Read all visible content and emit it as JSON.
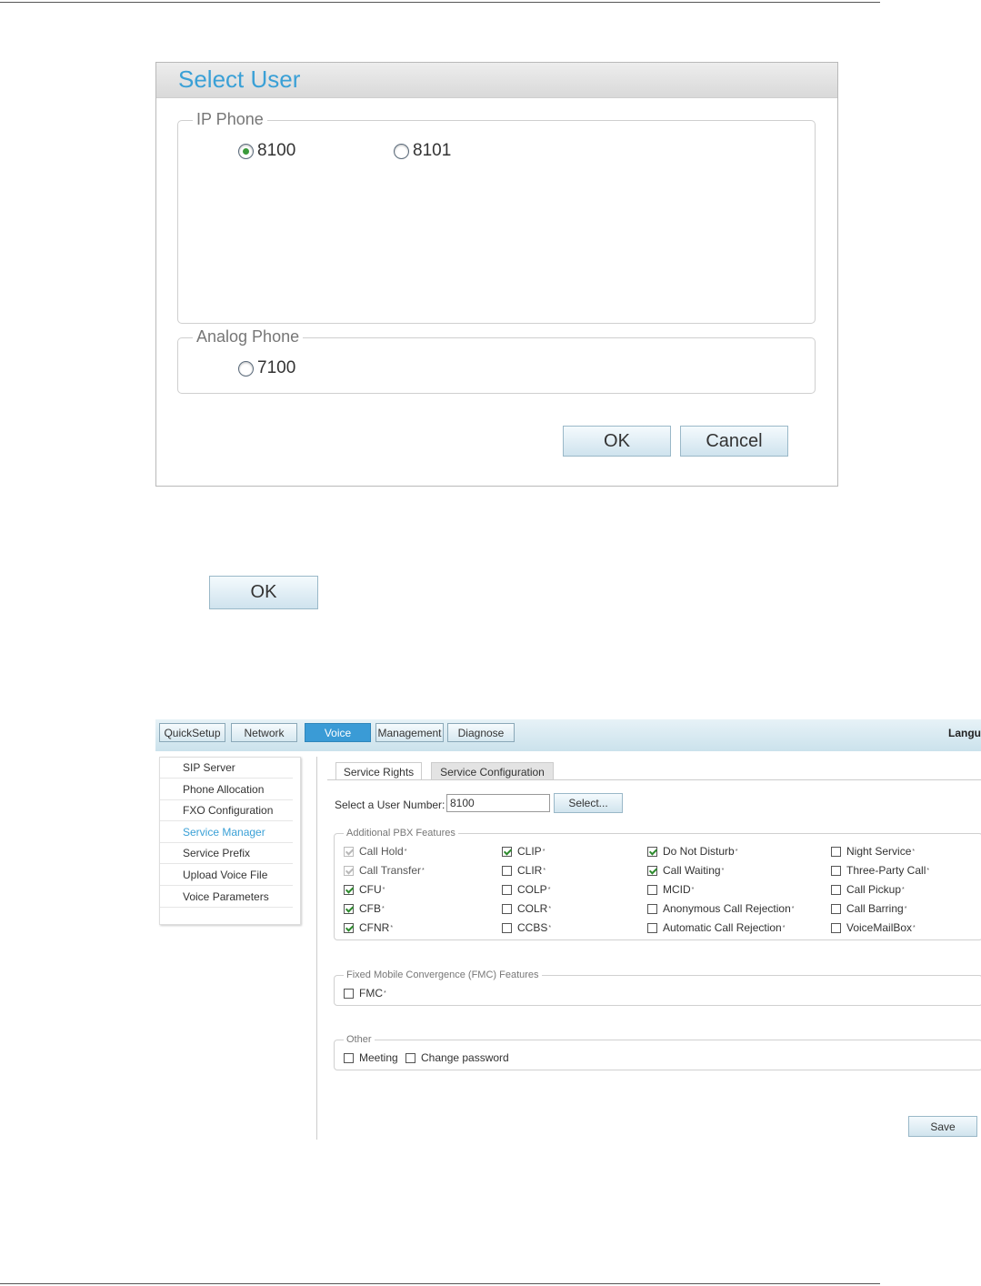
{
  "dialog": {
    "title": "Select User",
    "ip_phone": {
      "legend": "IP Phone",
      "options": [
        {
          "label": "8100",
          "selected": true
        },
        {
          "label": "8101",
          "selected": false
        }
      ]
    },
    "analog_phone": {
      "legend": "Analog Phone",
      "options": [
        {
          "label": "7100",
          "selected": false
        }
      ]
    },
    "ok_label": "OK",
    "cancel_label": "Cancel"
  },
  "standalone_ok_label": "OK",
  "webui": {
    "top_tabs": [
      {
        "label": "QuickSetup",
        "active": false
      },
      {
        "label": "Network",
        "active": false
      },
      {
        "label": "Voice",
        "active": true
      },
      {
        "label": "Management",
        "active": false
      },
      {
        "label": "Diagnose",
        "active": false
      }
    ],
    "language_label": "Langu",
    "sidebar": [
      {
        "label": "SIP Server",
        "active": false
      },
      {
        "label": "Phone Allocation",
        "active": false
      },
      {
        "label": "FXO Configuration",
        "active": false
      },
      {
        "label": "Service Manager",
        "active": true
      },
      {
        "label": "Service Prefix",
        "active": false
      },
      {
        "label": "Upload Voice File",
        "active": false
      },
      {
        "label": "Voice Parameters",
        "active": false
      }
    ],
    "content_tabs": [
      {
        "label": "Service Rights",
        "active": true
      },
      {
        "label": "Service Configuration",
        "active": false
      }
    ],
    "user_number_label": "Select a User Number:",
    "user_number_value": "8100",
    "select_button": "Select...",
    "pbx": {
      "legend": "Additional PBX Features",
      "columns": [
        [
          {
            "label": "Call Hold",
            "checked": true,
            "disabled": true
          },
          {
            "label": "Call Transfer",
            "checked": true,
            "disabled": true
          },
          {
            "label": "CFU",
            "checked": true,
            "disabled": false
          },
          {
            "label": "CFB",
            "checked": true,
            "disabled": false
          },
          {
            "label": "CFNR",
            "checked": true,
            "disabled": false
          }
        ],
        [
          {
            "label": "CLIP",
            "checked": true,
            "disabled": false
          },
          {
            "label": "CLIR",
            "checked": false,
            "disabled": false
          },
          {
            "label": "COLP",
            "checked": false,
            "disabled": false
          },
          {
            "label": "COLR",
            "checked": false,
            "disabled": false
          },
          {
            "label": "CCBS",
            "checked": false,
            "disabled": false
          }
        ],
        [
          {
            "label": "Do Not Disturb",
            "checked": true,
            "disabled": false
          },
          {
            "label": "Call Waiting",
            "checked": true,
            "disabled": false
          },
          {
            "label": "MCID",
            "checked": false,
            "disabled": false
          },
          {
            "label": "Anonymous Call Rejection",
            "checked": false,
            "disabled": false
          },
          {
            "label": "Automatic Call Rejection",
            "checked": false,
            "disabled": false
          }
        ],
        [
          {
            "label": "Night Service",
            "checked": false,
            "disabled": false
          },
          {
            "label": "Three-Party Call",
            "checked": false,
            "disabled": false
          },
          {
            "label": "Call Pickup",
            "checked": false,
            "disabled": false
          },
          {
            "label": "Call Barring",
            "checked": false,
            "disabled": false
          },
          {
            "label": "VoiceMailBox",
            "checked": false,
            "disabled": false
          }
        ]
      ]
    },
    "fmc": {
      "legend": "Fixed Mobile Convergence (FMC) Features",
      "items": [
        {
          "label": "FMC",
          "checked": false
        }
      ]
    },
    "other": {
      "legend": "Other",
      "items": [
        {
          "label": "Meeting",
          "checked": false
        },
        {
          "label": "Change password",
          "checked": false
        }
      ]
    },
    "save_label": "Save",
    "star_mark": "*"
  }
}
